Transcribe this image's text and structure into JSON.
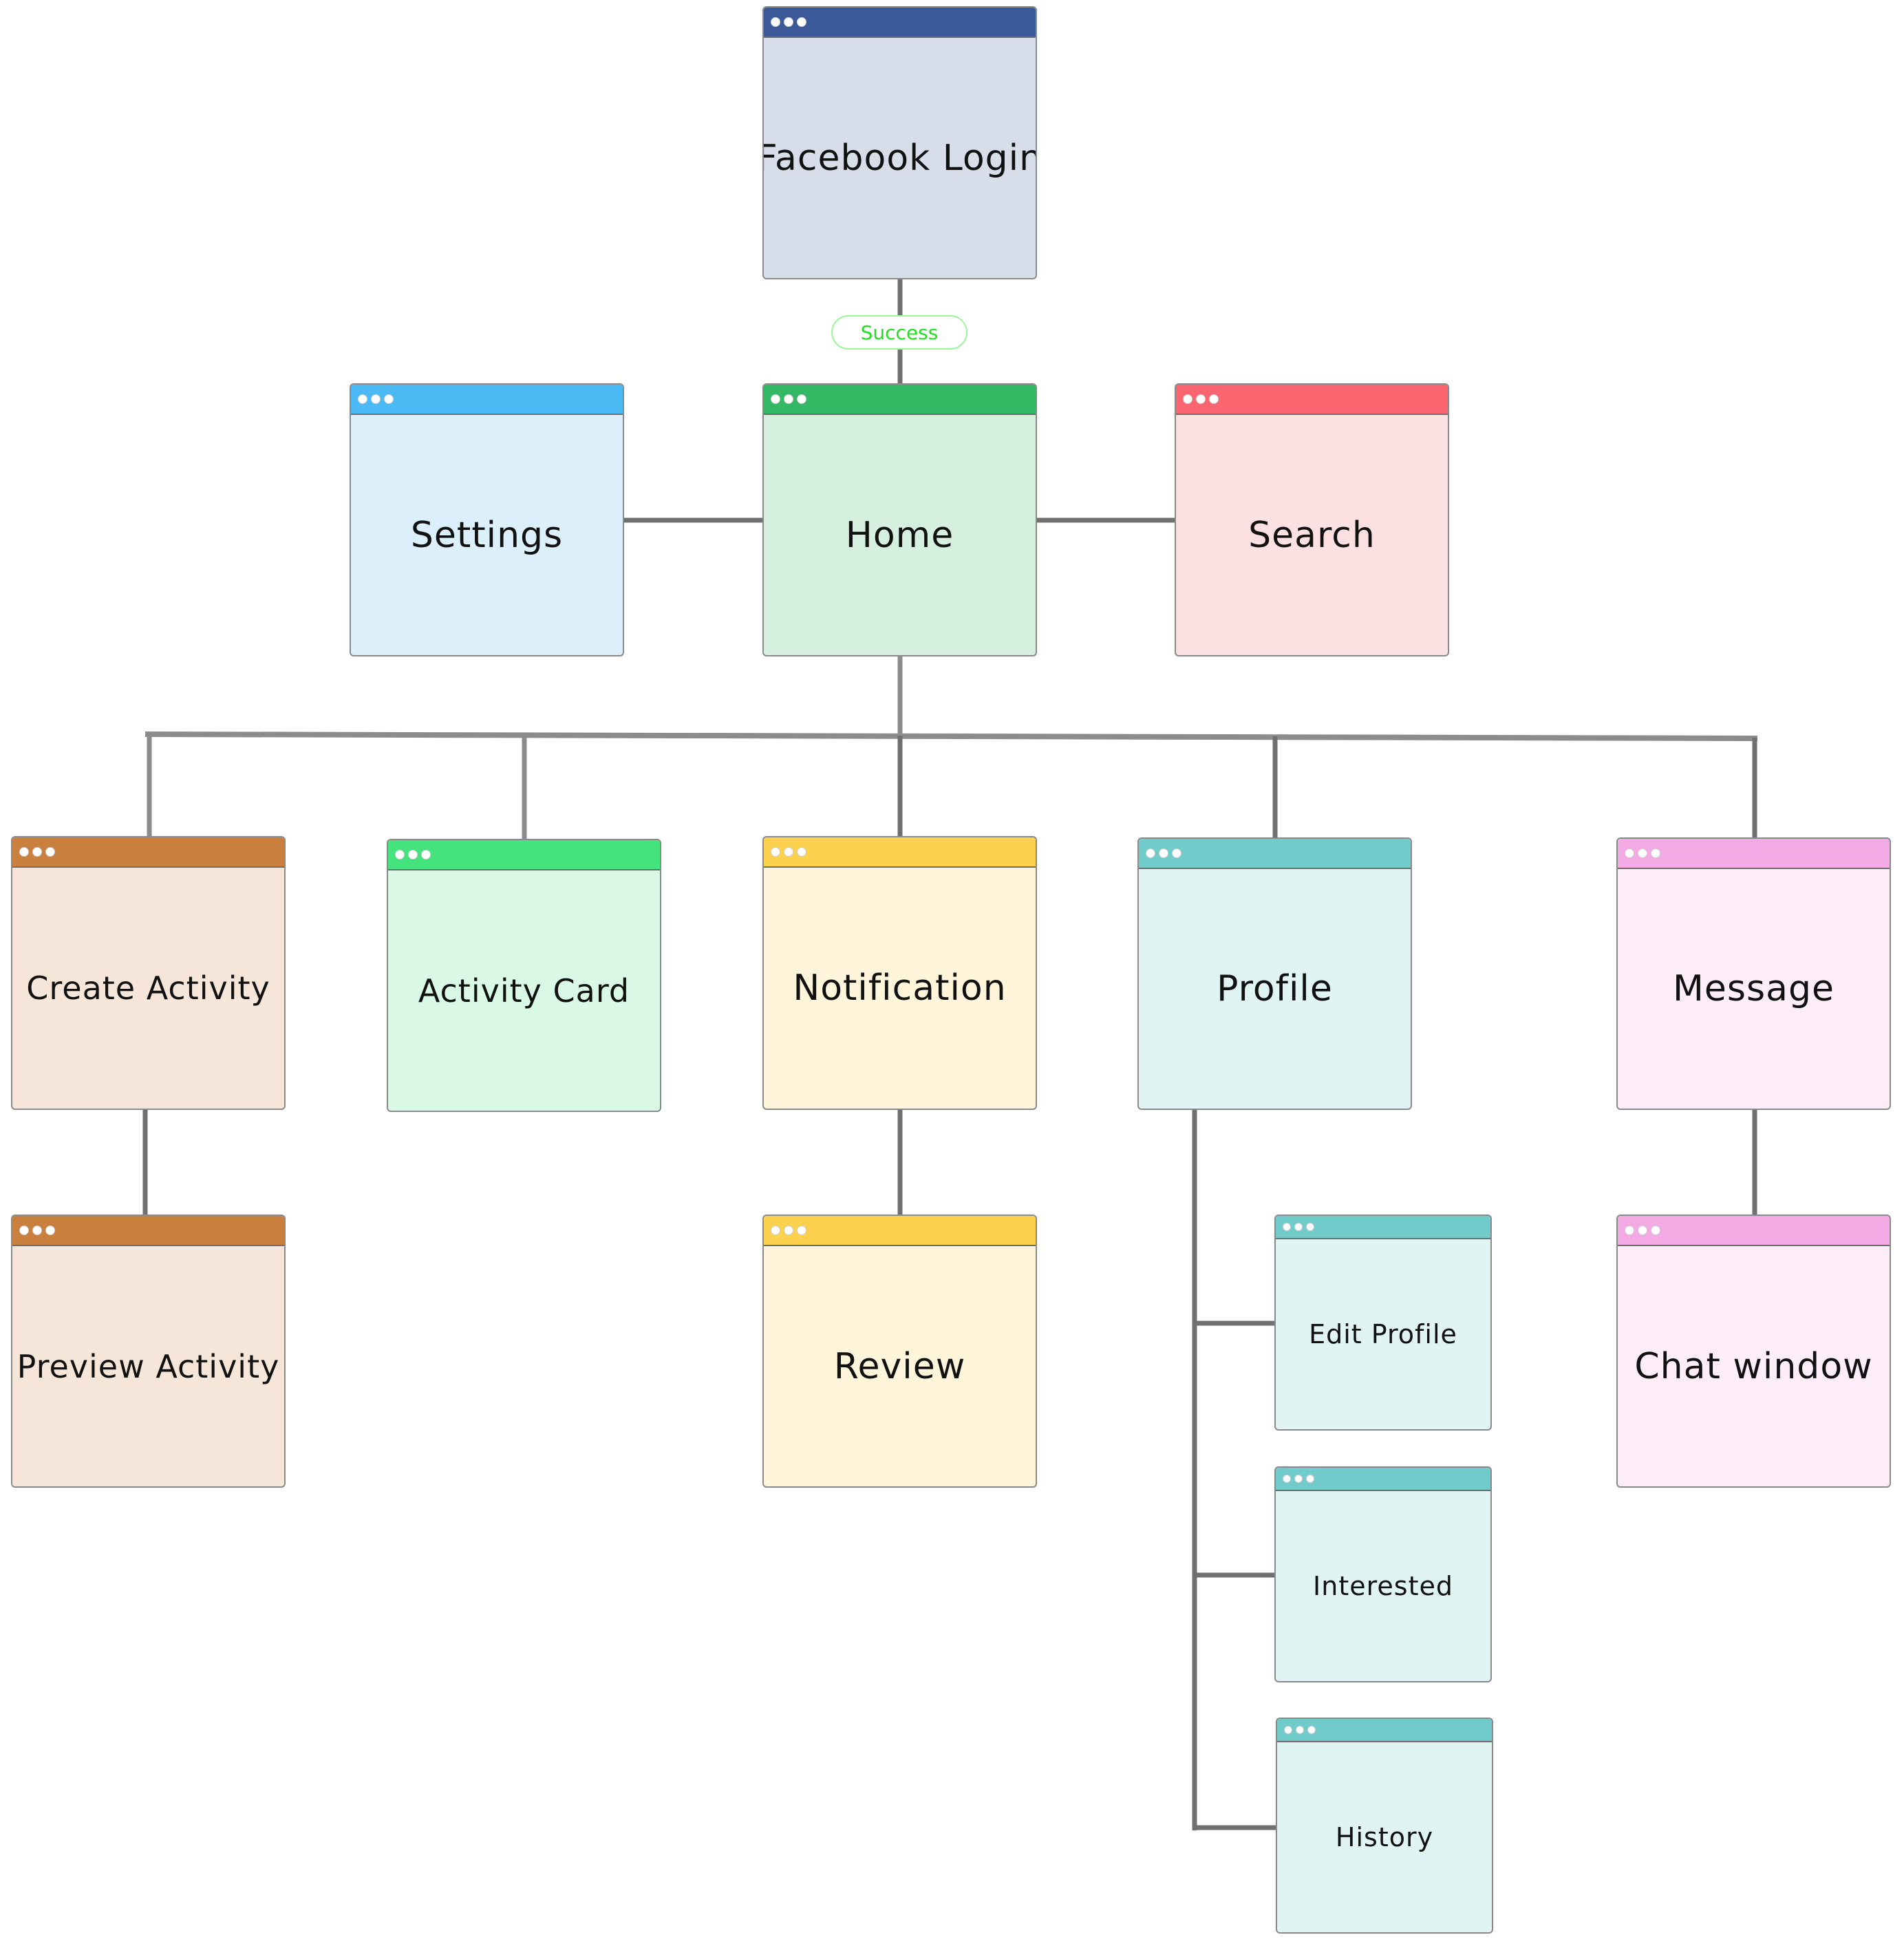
{
  "diagram": {
    "type": "app screen flow / site map",
    "edge_labels": {
      "login_to_home": "Success"
    },
    "nodes": {
      "facebook_login": {
        "label": "Facebook Login",
        "header_color": "#3b5998",
        "body_color": "#d7dde9"
      },
      "home": {
        "label": "Home",
        "header_color": "#33b864",
        "body_color": "#d6f0e0"
      },
      "settings": {
        "label": "Settings",
        "header_color": "#4bbaf4",
        "body_color": "#dbf0fb"
      },
      "search": {
        "label": "Search",
        "header_color": "#fa6570",
        "body_color": "#fde0e2"
      },
      "create_activity": {
        "label": "Create Activity",
        "header_color": "#c97f3e",
        "body_color": "#f5e6d9"
      },
      "activity_card": {
        "label": "Activity Card",
        "header_color": "#45e37e",
        "body_color": "#d9f8e6"
      },
      "notification": {
        "label": "Notification",
        "header_color": "#fbd14d",
        "body_color": "#fef5db"
      },
      "profile": {
        "label": "Profile",
        "header_color": "#72cbcb",
        "body_color": "#e0f4f4"
      },
      "message": {
        "label": "Message",
        "header_color": "#f2a9e4",
        "body_color": "#fcedf8"
      },
      "preview_activity": {
        "label": "Preview Activity",
        "header_color": "#c97f3e",
        "body_color": "#f5e6d9"
      },
      "review": {
        "label": "Review",
        "header_color": "#fbd14d",
        "body_color": "#fef5db"
      },
      "chat_window": {
        "label": "Chat window",
        "header_color": "#f2a9e4",
        "body_color": "#fcedf8"
      },
      "edit_profile": {
        "label": "Edit Profile",
        "header_color": "#72cbcb",
        "body_color": "#e0f4f4"
      },
      "interested": {
        "label": "Interested",
        "header_color": "#72cbcb",
        "body_color": "#e0f4f4"
      },
      "history": {
        "label": "History",
        "header_color": "#72cbcb",
        "body_color": "#e0f4f4"
      }
    },
    "edges": [
      [
        "facebook_login",
        "home"
      ],
      [
        "home",
        "settings"
      ],
      [
        "home",
        "search"
      ],
      [
        "home",
        "create_activity"
      ],
      [
        "home",
        "activity_card"
      ],
      [
        "home",
        "notification"
      ],
      [
        "home",
        "profile"
      ],
      [
        "home",
        "message"
      ],
      [
        "create_activity",
        "preview_activity"
      ],
      [
        "notification",
        "review"
      ],
      [
        "message",
        "chat_window"
      ],
      [
        "profile",
        "edit_profile"
      ],
      [
        "profile",
        "interested"
      ],
      [
        "profile",
        "history"
      ]
    ],
    "connector_color": "#707070"
  }
}
